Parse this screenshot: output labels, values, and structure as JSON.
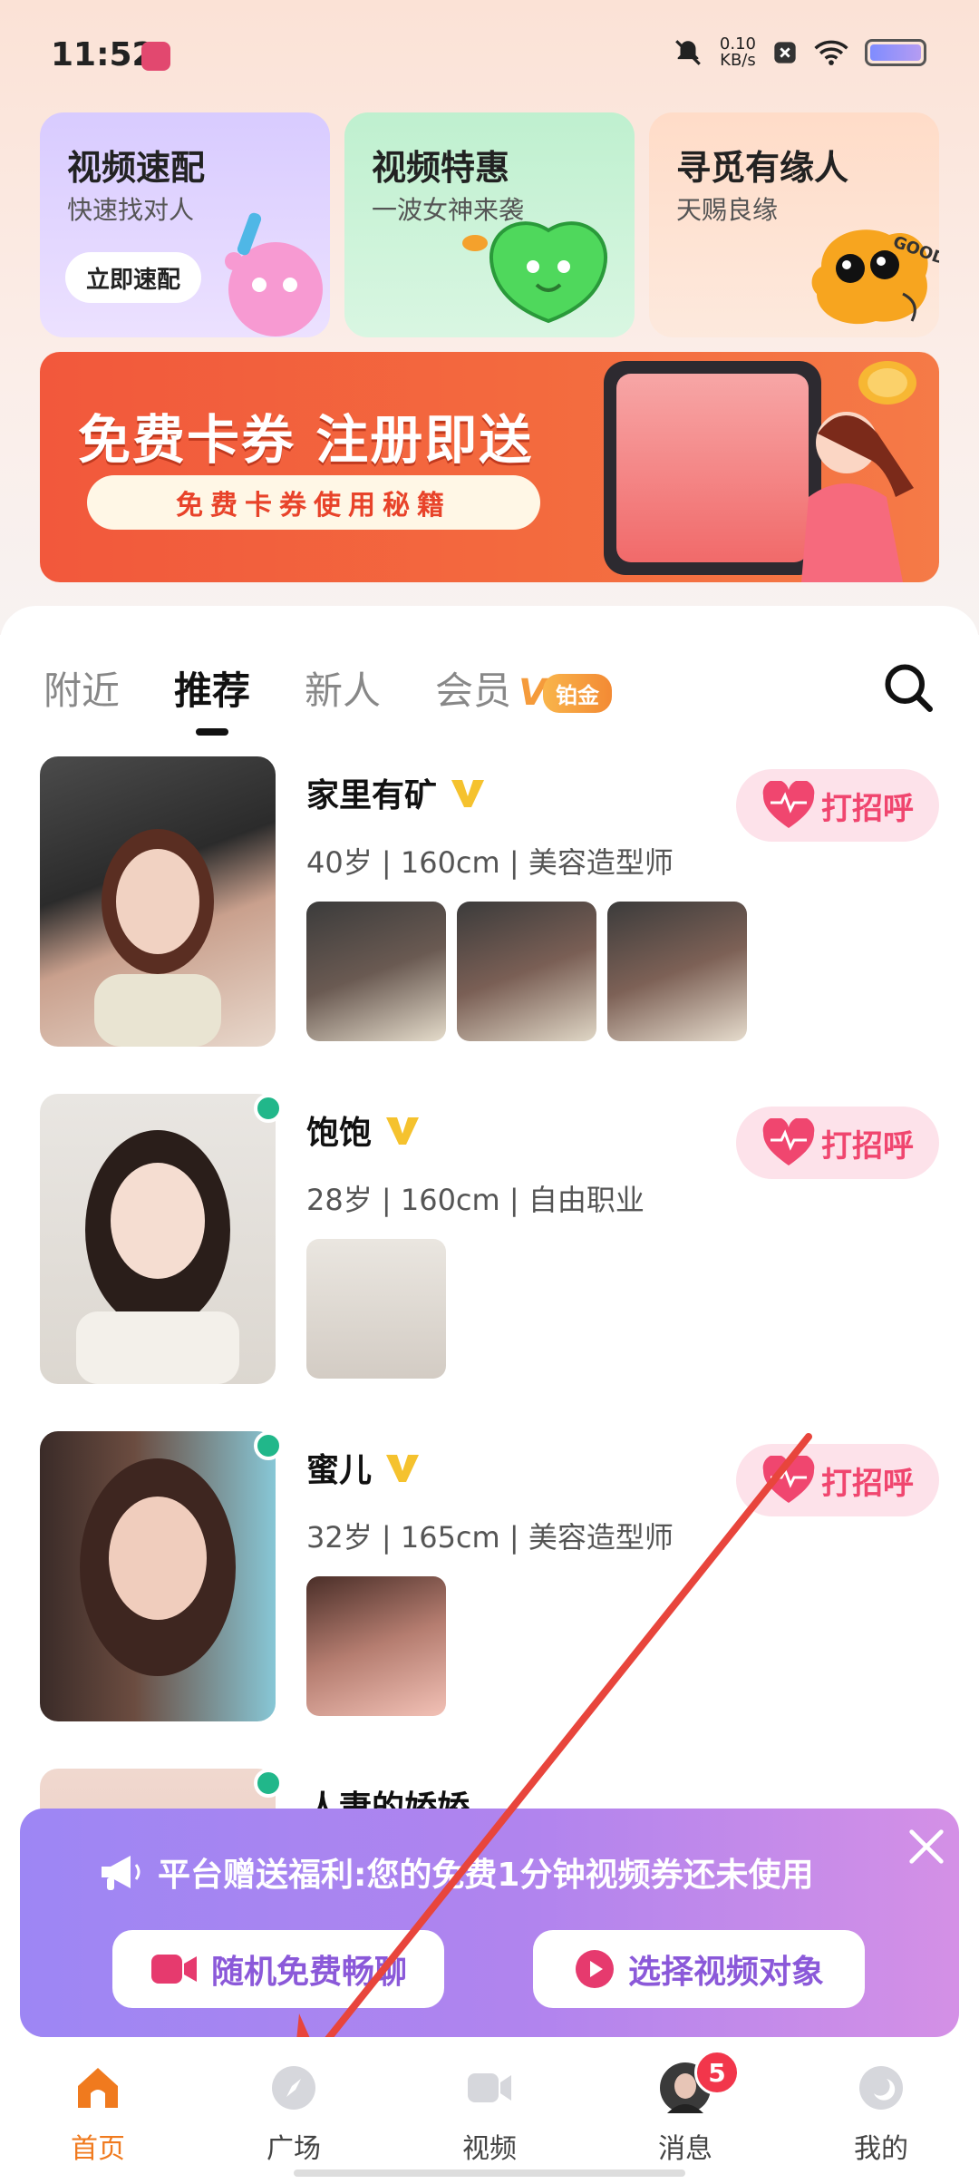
{
  "status_bar": {
    "time": "11:52",
    "net_speed_value": "0.10",
    "net_speed_unit": "KB/s"
  },
  "feature_cards": [
    {
      "title": "视频速配",
      "subtitle": "快速找对人",
      "button": "立即速配"
    },
    {
      "title": "视频特惠",
      "subtitle": "一波女神来袭"
    },
    {
      "title": "寻觅有缘人",
      "subtitle": "天赐良缘",
      "mascot_text": "GOOD"
    }
  ],
  "banner": {
    "title": "免费卡券 注册即送",
    "pill": "免费卡券使用秘籍"
  },
  "tabs": {
    "nearby": "附近",
    "recommended": "推荐",
    "newbie": "新人",
    "member": "会员",
    "member_badge": "铂金",
    "active": "推荐"
  },
  "profiles": [
    {
      "name": "家里有矿",
      "info": "40岁 | 160cm | 美容造型师",
      "greet": "打招呼",
      "thumbs": 3,
      "online": false
    },
    {
      "name": "饱饱",
      "info": "28岁 | 160cm | 自由职业",
      "greet": "打招呼",
      "thumbs": 1,
      "online": true
    },
    {
      "name": "蜜儿",
      "info": "32岁 | 165cm | 美容造型师",
      "greet": "打招呼",
      "thumbs": 1,
      "online": true
    },
    {
      "name": "人妻的娇娇",
      "online": true
    }
  ],
  "promo": {
    "text": "平台赠送福利:您的免费1分钟视频券还未使用",
    "btn_random": "随机免费畅聊",
    "btn_choose": "选择视频对象"
  },
  "bottom_nav": {
    "items": [
      {
        "label": "首页",
        "icon": "home-icon"
      },
      {
        "label": "广场",
        "icon": "compass-icon"
      },
      {
        "label": "视频",
        "icon": "video-icon"
      },
      {
        "label": "消息",
        "icon": "message-icon"
      },
      {
        "label": "我的",
        "icon": "profile-icon"
      }
    ],
    "active": "首页",
    "message_badge": "5"
  },
  "colors": {
    "accent_orange": "#f07a1e",
    "greet_pink": "#f0466f",
    "online_green": "#21b78a",
    "promo_purple": "#9d86f4",
    "arrow_red": "#e8453c"
  }
}
